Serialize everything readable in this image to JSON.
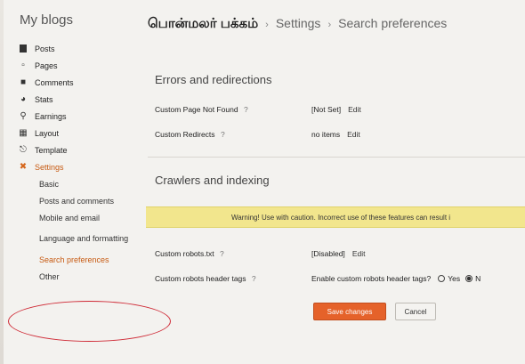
{
  "sidebar": {
    "title": "My blogs",
    "items": [
      {
        "label": "Posts",
        "icon": "posts-icon"
      },
      {
        "label": "Pages",
        "icon": "pages-icon"
      },
      {
        "label": "Comments",
        "icon": "comments-icon"
      },
      {
        "label": "Stats",
        "icon": "stats-icon"
      },
      {
        "label": "Earnings",
        "icon": "earnings-icon"
      },
      {
        "label": "Layout",
        "icon": "layout-icon"
      },
      {
        "label": "Template",
        "icon": "template-icon"
      },
      {
        "label": "Settings",
        "icon": "wrench-icon"
      }
    ],
    "settings_subitems": [
      {
        "label": "Basic"
      },
      {
        "label": "Posts and comments"
      },
      {
        "label": "Mobile and email"
      },
      {
        "label": "Language and formatting"
      },
      {
        "label": "Search preferences"
      },
      {
        "label": "Other"
      }
    ]
  },
  "header": {
    "blog_name": "பொன்மலர் பக்கம்",
    "crumb_1": "Settings",
    "crumb_2": "Search preferences"
  },
  "errors_section": {
    "title": "Errors and redirections",
    "custom_page_not_found": {
      "label": "Custom Page Not Found",
      "help": "?",
      "value": "[Not Set]",
      "edit": "Edit"
    },
    "custom_redirects": {
      "label": "Custom Redirects",
      "help": "?",
      "value": "no items",
      "edit": "Edit"
    }
  },
  "crawlers_section": {
    "title": "Crawlers and indexing",
    "warning": "Warning! Use with caution. Incorrect use of these features can result i",
    "custom_robots_txt": {
      "label": "Custom robots.txt",
      "help": "?",
      "value": "[Disabled]",
      "edit": "Edit"
    },
    "custom_robots_header_tags": {
      "label": "Custom robots header tags",
      "help": "?",
      "question": "Enable custom robots header tags?",
      "yes_label": "Yes",
      "no_label": "N"
    }
  },
  "buttons": {
    "save": "Save changes",
    "cancel": "Cancel"
  },
  "annotation": {
    "color": "#cf2a36"
  },
  "colors": {
    "accent": "#c75a12",
    "save_button": "#e5622a",
    "warning_bg": "#f2e68d"
  }
}
